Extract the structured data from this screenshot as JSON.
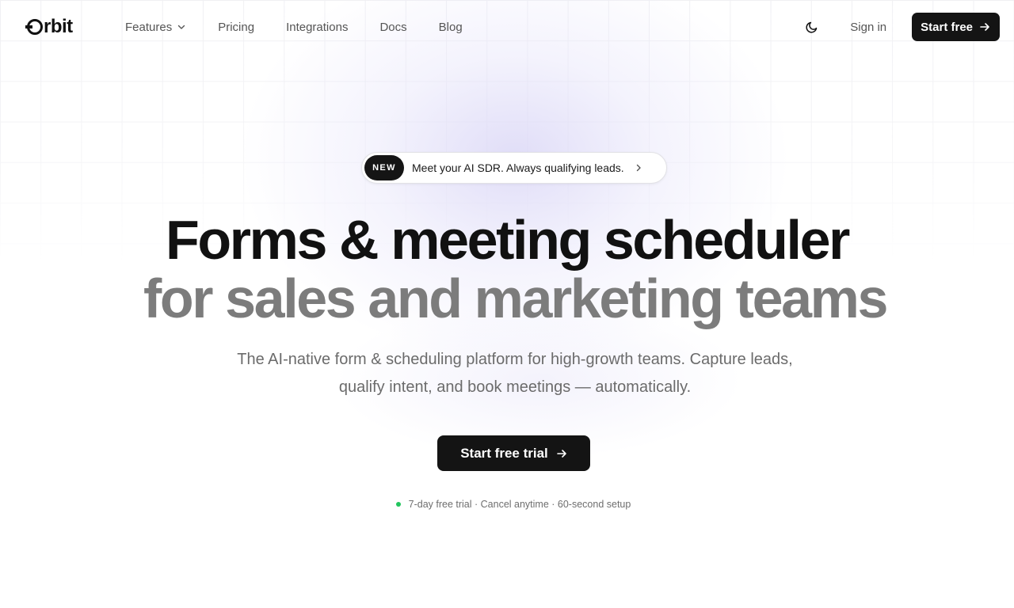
{
  "brand": {
    "logo_text": "rbit",
    "logo_full": "Orbit"
  },
  "nav": {
    "links": [
      {
        "label": "Features",
        "has_dropdown": true
      },
      {
        "label": "Pricing"
      },
      {
        "label": "Integrations"
      },
      {
        "label": "Docs"
      },
      {
        "label": "Blog"
      }
    ],
    "theme_icon": "moon-icon",
    "signin_label": "Sign in",
    "start_label": "Start free"
  },
  "announcement": {
    "badge": "NEW",
    "text": "Meet your AI SDR. Always qualifying leads.",
    "icon": "chevron-right-icon"
  },
  "hero": {
    "headline_line1": "Forms & meeting scheduler",
    "headline_line2": "for sales and marketing teams",
    "subhead": "The AI-native form & scheduling platform for high-growth teams. Capture leads, qualify intent, and book meetings — automatically.",
    "cta_label": "Start free trial",
    "trust_text": "7-day free trial · Cancel anytime · 60-second setup"
  },
  "colors": {
    "primary": "#141414",
    "headline": "#111111",
    "headline_muted": "#7c7c7c",
    "body_muted": "#6b6b6b",
    "status_dot": "#22c55e",
    "glow": "#d6d2f5"
  }
}
